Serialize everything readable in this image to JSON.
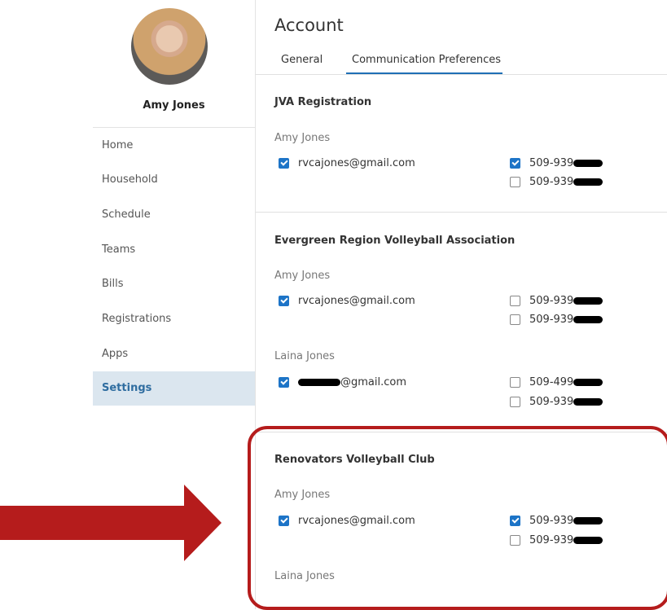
{
  "profile": {
    "name": "Amy Jones"
  },
  "nav": {
    "items": [
      {
        "label": "Home"
      },
      {
        "label": "Household"
      },
      {
        "label": "Schedule"
      },
      {
        "label": "Teams"
      },
      {
        "label": "Bills"
      },
      {
        "label": "Registrations"
      },
      {
        "label": "Apps"
      },
      {
        "label": "Settings",
        "active": true
      }
    ]
  },
  "header": {
    "title": "Account",
    "tabs": [
      {
        "label": "General"
      },
      {
        "label": "Communication Preferences",
        "active": true
      }
    ]
  },
  "sections": [
    {
      "title": "JVA Registration",
      "people": [
        {
          "name": "Amy Jones",
          "email": "rvcajones@gmail.com",
          "email_checked": true,
          "phones": [
            {
              "number": "509-939",
              "checked": true
            },
            {
              "number": "509-939",
              "checked": false
            }
          ]
        }
      ]
    },
    {
      "title": "Evergreen Region Volleyball Association",
      "people": [
        {
          "name": "Amy Jones",
          "email": "rvcajones@gmail.com",
          "email_checked": true,
          "phones": [
            {
              "number": "509-939",
              "checked": false
            },
            {
              "number": "509-939",
              "checked": false
            }
          ]
        },
        {
          "name": "Laina Jones",
          "email": "@gmail.com",
          "email_checked": true,
          "phones": [
            {
              "number": "509-499",
              "checked": false
            },
            {
              "number": "509-939",
              "checked": false
            }
          ]
        }
      ]
    },
    {
      "title": "Renovators Volleyball Club",
      "people": [
        {
          "name": "Amy Jones",
          "email": "rvcajones@gmail.com",
          "email_checked": true,
          "phones": [
            {
              "number": "509-939",
              "checked": true
            },
            {
              "number": "509-939",
              "checked": false
            }
          ]
        },
        {
          "name": "Laina Jones"
        }
      ]
    }
  ],
  "colors": {
    "accent": "#1d74c7",
    "annotation": "#b51c1c",
    "active_nav_bg": "#dbe6ef"
  }
}
